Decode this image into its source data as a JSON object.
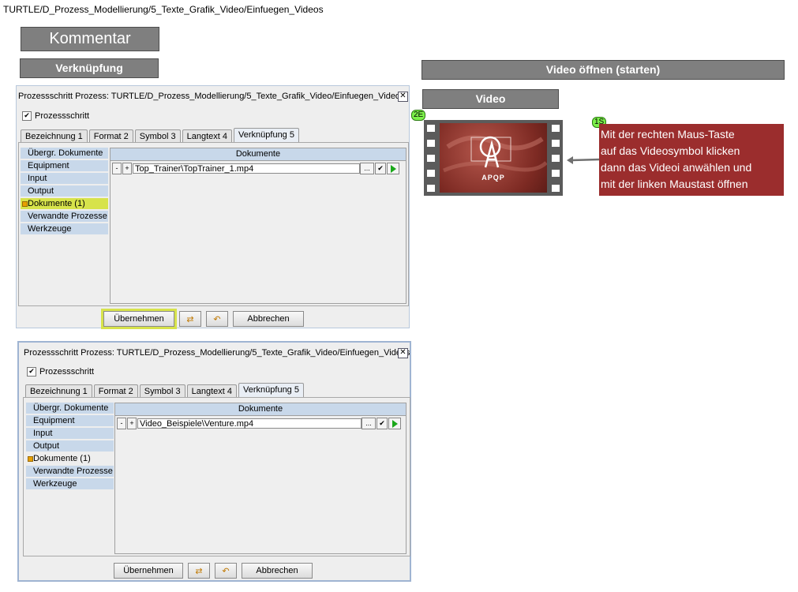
{
  "page_title": "TURTLE/D_Prozess_Modellierung/5_Texte_Grafik_Video/Einfuegen_Videos",
  "headers": {
    "kommentar": "Kommentar",
    "verknuepfung": "Verknüpfung",
    "video_open": "Video öffnen (starten)",
    "video": "Video"
  },
  "dialog1": {
    "title": "Prozessschritt Prozess: TURTLE/D_Prozess_Modellierung/5_Texte_Grafik_Video/Einfuegen_Videos",
    "checkbox_label": "Prozessschritt",
    "tabs": [
      "Bezeichnung 1",
      "Format 2",
      "Symbol 3",
      "Langtext 4",
      "Verknüpfung 5"
    ],
    "nav": [
      "Übergr. Dokumente",
      "Equipment",
      "Input",
      "Output",
      "Dokumente (1)",
      "Verwandte Prozesse",
      "Werkzeuge"
    ],
    "doc_header": "Dokumente",
    "doc_value": "Top_Trainer\\TopTrainer_1.mp4",
    "buttons": {
      "apply": "Übernehmen",
      "cancel": "Abbrechen"
    }
  },
  "dialog2": {
    "title": "Prozessschritt Prozess: TURTLE/D_Prozess_Modellierung/5_Texte_Grafik_Video/Einfuegen_Videos",
    "checkbox_label": "Prozessschritt",
    "tabs": [
      "Bezeichnung 1",
      "Format 2",
      "Symbol 3",
      "Langtext 4",
      "Verknüpfung 5"
    ],
    "nav": [
      "Übergr. Dokumente",
      "Equipment",
      "Input",
      "Output",
      "Dokumente (1)",
      "Verwandte Prozesse",
      "Werkzeuge"
    ],
    "doc_header": "Dokumente",
    "doc_value": "Video_Beispiele\\Venture.mp4",
    "buttons": {
      "apply": "Übernehmen",
      "cancel": "Abbrechen"
    }
  },
  "video_widget": {
    "badge_left": "2E",
    "badge_note": "1S",
    "logo_text": "APQP",
    "note_lines": [
      "Mit der rechten Maus-Taste",
      "auf das Videosymbol klicken",
      "dann das Videoi anwählen und",
      "mit der linken Maustast öffnen"
    ]
  },
  "colors": {
    "header_gray": "#7f7f7f",
    "note_red": "#9b2d2d",
    "highlight": "#d7e34b",
    "badge_green": "#7cf04a"
  }
}
